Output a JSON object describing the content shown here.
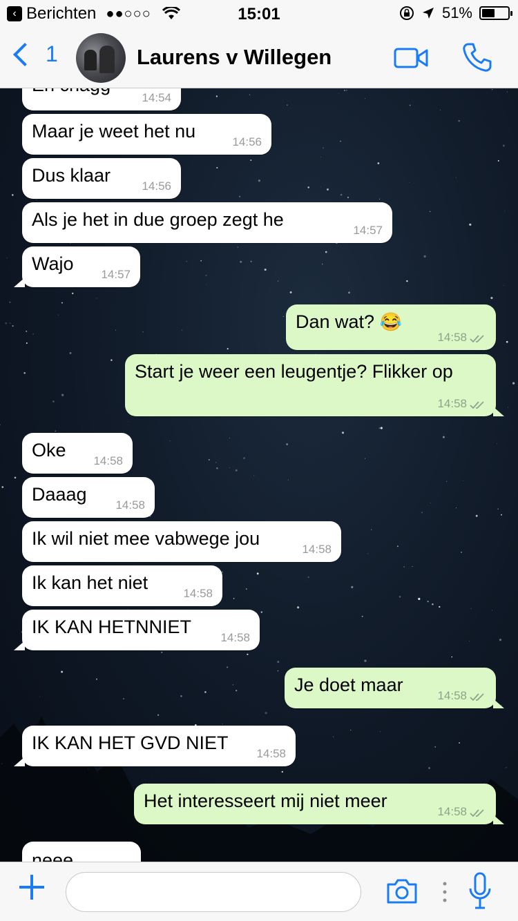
{
  "status_bar": {
    "back_app": "Berichten",
    "signal": "●●○○○",
    "time": "15:01",
    "battery_percent": "51%",
    "battery_level": 0.51
  },
  "header": {
    "back_count": "1",
    "contact_name": "Laurens v Willegen"
  },
  "messages": [
    {
      "dir": "in",
      "text": "En chagg",
      "time": "14:54"
    },
    {
      "dir": "in",
      "text": "Maar je weet het nu",
      "time": "14:56"
    },
    {
      "dir": "in",
      "text": "Dus klaar",
      "time": "14:56"
    },
    {
      "dir": "in",
      "text": "Als je het in due groep zegt he",
      "time": "14:57"
    },
    {
      "dir": "in",
      "text": "Wajo",
      "time": "14:57"
    },
    {
      "dir": "out",
      "text": "Dan wat? ",
      "emoji": "😂",
      "time": "14:58"
    },
    {
      "dir": "out",
      "text": "Start je weer een leugentje? Flikker op",
      "time": "14:58"
    },
    {
      "dir": "in",
      "text": "Oke",
      "time": "14:58"
    },
    {
      "dir": "in",
      "text": "Daaag",
      "time": "14:58"
    },
    {
      "dir": "in",
      "text": "Ik wil niet mee vabwege jou",
      "time": "14:58"
    },
    {
      "dir": "in",
      "text": "Ik kan het niet",
      "time": "14:58"
    },
    {
      "dir": "in",
      "text": "IK KAN HETNNIET",
      "time": "14:58"
    },
    {
      "dir": "out",
      "text": "Je doet maar",
      "time": "14:58"
    },
    {
      "dir": "in",
      "text": "IK KAN HET GVD NIET",
      "time": "14:58"
    },
    {
      "dir": "out",
      "text": "Het interesseert mij niet meer",
      "time": "14:58"
    },
    {
      "dir": "in",
      "text": "neee",
      "time": ""
    }
  ],
  "input": {
    "placeholder": "",
    "value": ""
  },
  "colors": {
    "accent": "#1a7cf5",
    "bubble_in": "#ffffff",
    "bubble_out": "#dcf8c6"
  },
  "icons": [
    "back-chevron-icon",
    "video-call-icon",
    "phone-icon",
    "plus-icon",
    "camera-icon",
    "microphone-icon",
    "read-ticks-icon"
  ]
}
